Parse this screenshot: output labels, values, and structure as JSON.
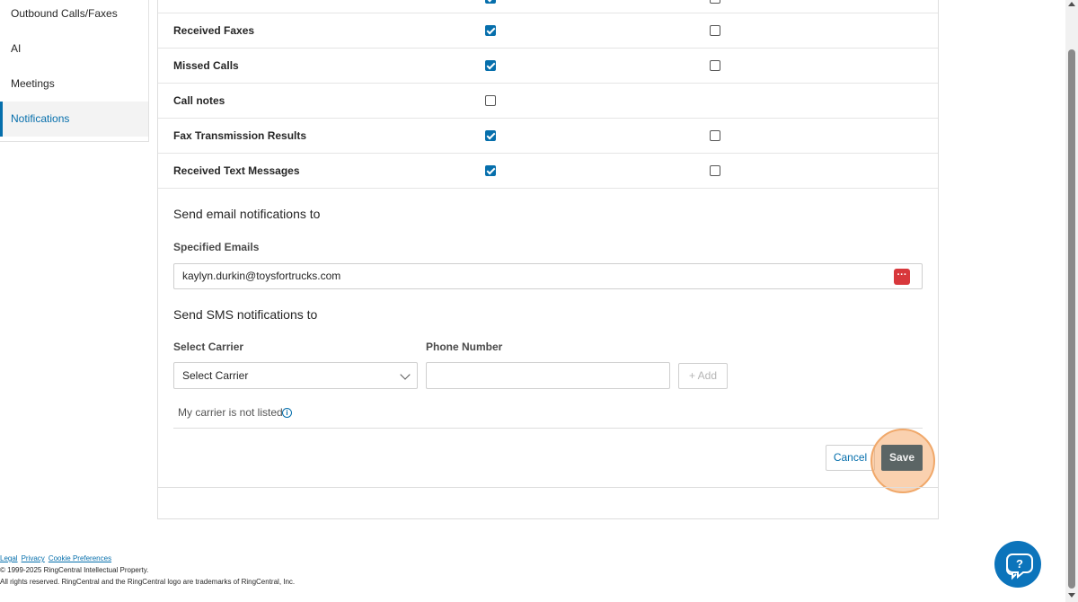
{
  "sidebar": {
    "items": [
      {
        "label": "Outbound Calls/Faxes"
      },
      {
        "label": "AI"
      },
      {
        "label": "Meetings"
      },
      {
        "label": "Notifications"
      }
    ]
  },
  "notifications": {
    "rows": [
      {
        "label": "Received Faxes",
        "email": true,
        "sms": false
      },
      {
        "label": "Missed Calls",
        "email": true,
        "sms": false
      },
      {
        "label": "Call notes",
        "email": false,
        "sms": null
      },
      {
        "label": "Fax Transmission Results",
        "email": true,
        "sms": false
      },
      {
        "label": "Received Text Messages",
        "email": true,
        "sms": false
      }
    ]
  },
  "email_section": {
    "title": "Send email notifications to",
    "field_label": "Specified Emails",
    "value": "kaylyn.durkin@toysfortrucks.com",
    "dots_icon": "···"
  },
  "sms_section": {
    "title": "Send SMS notifications to",
    "carrier_label": "Select Carrier",
    "carrier_value": "Select Carrier",
    "phone_label": "Phone Number",
    "phone_value": "",
    "add_label": "+ Add",
    "carrier_not_listed": "My carrier is not listed",
    "info_icon": "i"
  },
  "actions": {
    "cancel_label": "Cancel",
    "save_label": "Save"
  },
  "footer": {
    "links": [
      "Legal",
      "Privacy",
      "Cookie Preferences"
    ],
    "copyright": "© 1999-2025 RingCentral Intellectual Property.",
    "rights": "All rights reserved. RingCentral and the RingCentral logo are trademarks of RingCentral, Inc."
  },
  "colors": {
    "accent": "#066fac",
    "save_button": "#5b6565",
    "highlight": "#f6ac6e",
    "help_fab": "#0c74bb"
  },
  "icons": {
    "help": "help-chat-icon",
    "chevron": "chevron-down-icon"
  }
}
